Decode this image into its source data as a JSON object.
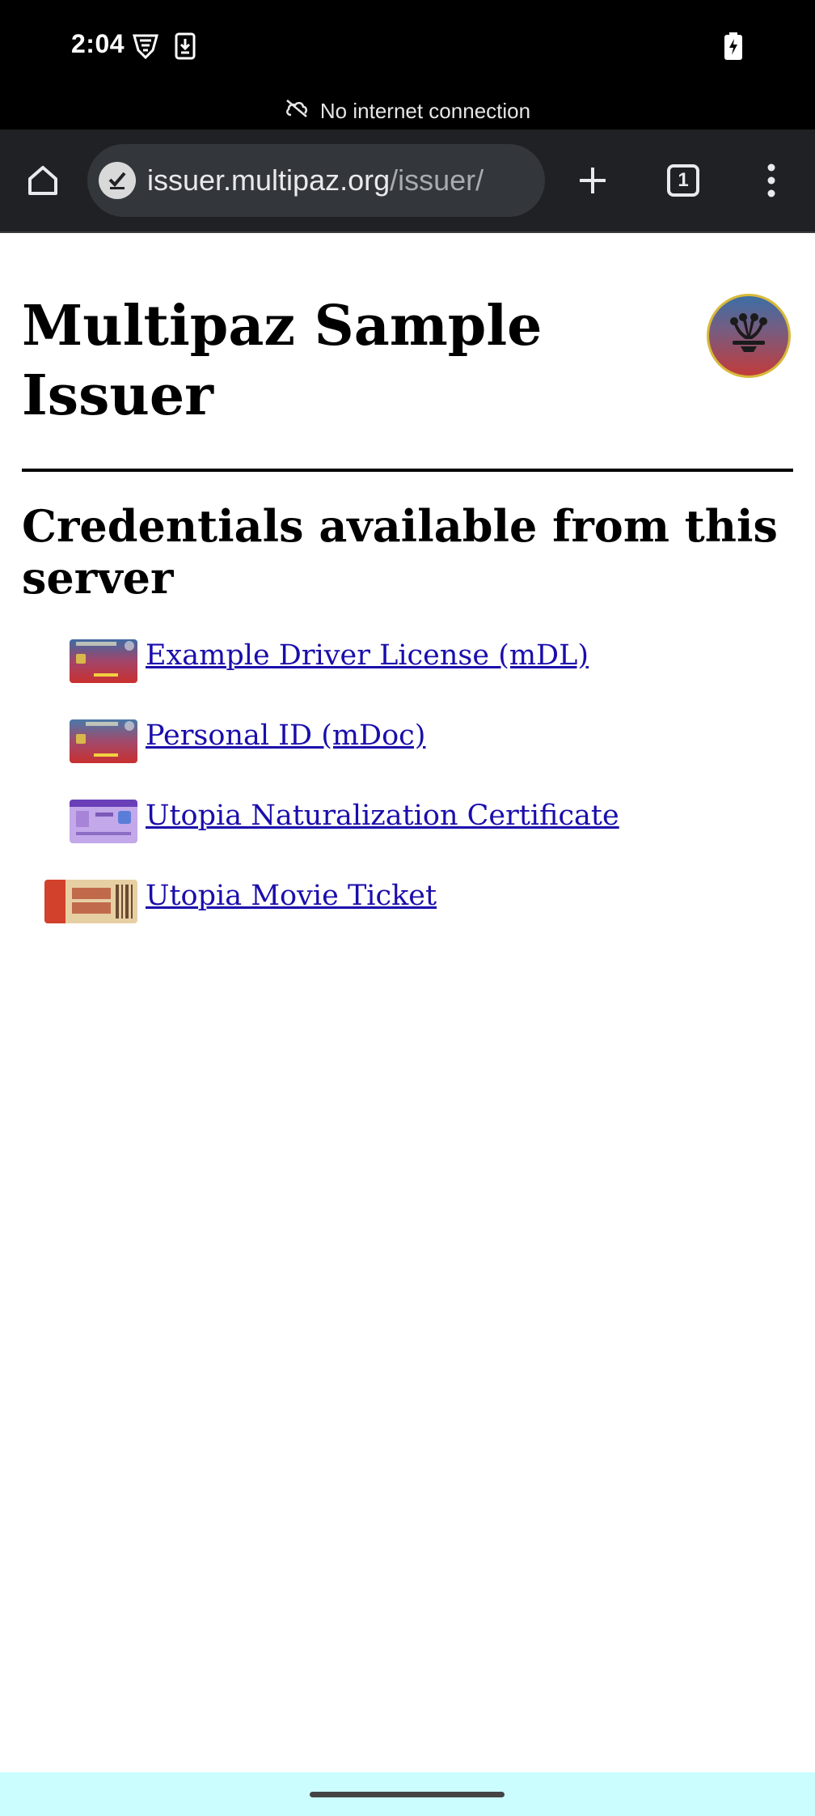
{
  "status_bar": {
    "time": "2:04",
    "icons": [
      "vpn-shield-icon",
      "download-icon",
      "battery-charging-icon"
    ]
  },
  "offline_banner": {
    "icon": "cloud-off-icon",
    "text": "No internet connection"
  },
  "browser": {
    "url_host": "issuer.multipaz.org",
    "url_path": "/issuer/",
    "tab_count": "1",
    "buttons": [
      "home-icon",
      "new-tab-icon",
      "tab-switcher-icon",
      "more-menu-icon"
    ]
  },
  "page": {
    "title": "Multipaz Sample Issuer",
    "section_title": "Credentials available from this server",
    "credentials": [
      {
        "label": "Example Driver License (mDL)",
        "thumb": "driver-license-card"
      },
      {
        "label": "Personal ID (mDoc)",
        "thumb": "personal-id-card"
      },
      {
        "label": "Utopia Naturalization Certificate",
        "thumb": "naturalization-certificate"
      },
      {
        "label": "Utopia Movie Ticket",
        "thumb": "movie-ticket"
      }
    ]
  },
  "colors": {
    "link": "#1a0dab",
    "toolbar_bg": "#1f2124",
    "omnibox_bg": "#33363a",
    "nav_bar_bg": "#cbfdfe"
  }
}
